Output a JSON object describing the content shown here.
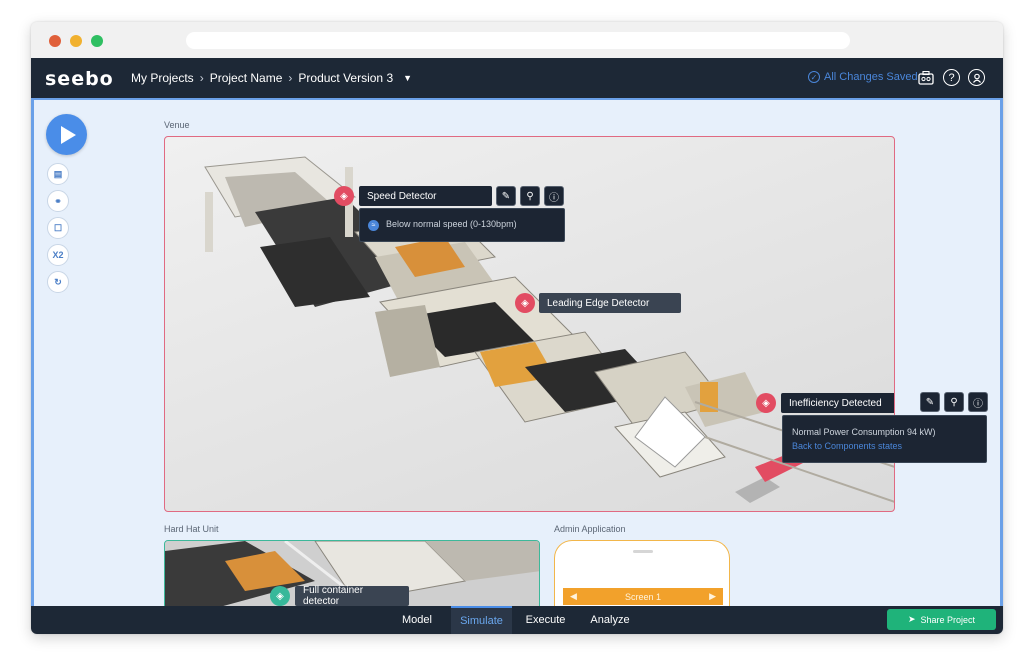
{
  "app": {
    "logo_text": "seebo"
  },
  "breadcrumbs": [
    "My Projects",
    "Project Name",
    "Product Version 3"
  ],
  "header": {
    "saved_status": "All Changes Saved"
  },
  "sidebar": {
    "tools": [
      {
        "icon": "document-icon",
        "glyph": "▤"
      },
      {
        "icon": "hierarchy-icon",
        "glyph": "⚭"
      },
      {
        "icon": "comment-icon",
        "glyph": "☐"
      },
      {
        "icon": "speed-x2-icon",
        "glyph": "X2"
      },
      {
        "icon": "reset-icon",
        "glyph": "↻"
      }
    ]
  },
  "sections": {
    "venue": "Venue",
    "hardhat": "Hard Hat Unit",
    "admin": "Admin Application"
  },
  "components": {
    "speed_detector": {
      "name": "Speed Detector",
      "state": "Below normal speed (0-130bpm)"
    },
    "leading_edge": {
      "name": "Leading Edge Detector"
    },
    "inefficiency": {
      "name": "Inefficiency Detected",
      "detail": "Normal Power Consumption 94 kW)",
      "link": "Back to Components states"
    },
    "full_container": {
      "name": "Full container detector"
    }
  },
  "admin_app": {
    "screen_label": "Screen 1"
  },
  "bottom_tabs": [
    {
      "label": "Model",
      "active": false
    },
    {
      "label": "Simulate",
      "active": true
    },
    {
      "label": "Execute",
      "active": false
    },
    {
      "label": "Analyze",
      "active": false
    }
  ],
  "share_button": "Share Project",
  "colors": {
    "navbar": "#1d2836",
    "accent_blue": "#4a8de8",
    "alert_red": "#e24c62",
    "teal": "#37b89a",
    "orange": "#f2a12b",
    "share_green": "#1fb37a"
  }
}
